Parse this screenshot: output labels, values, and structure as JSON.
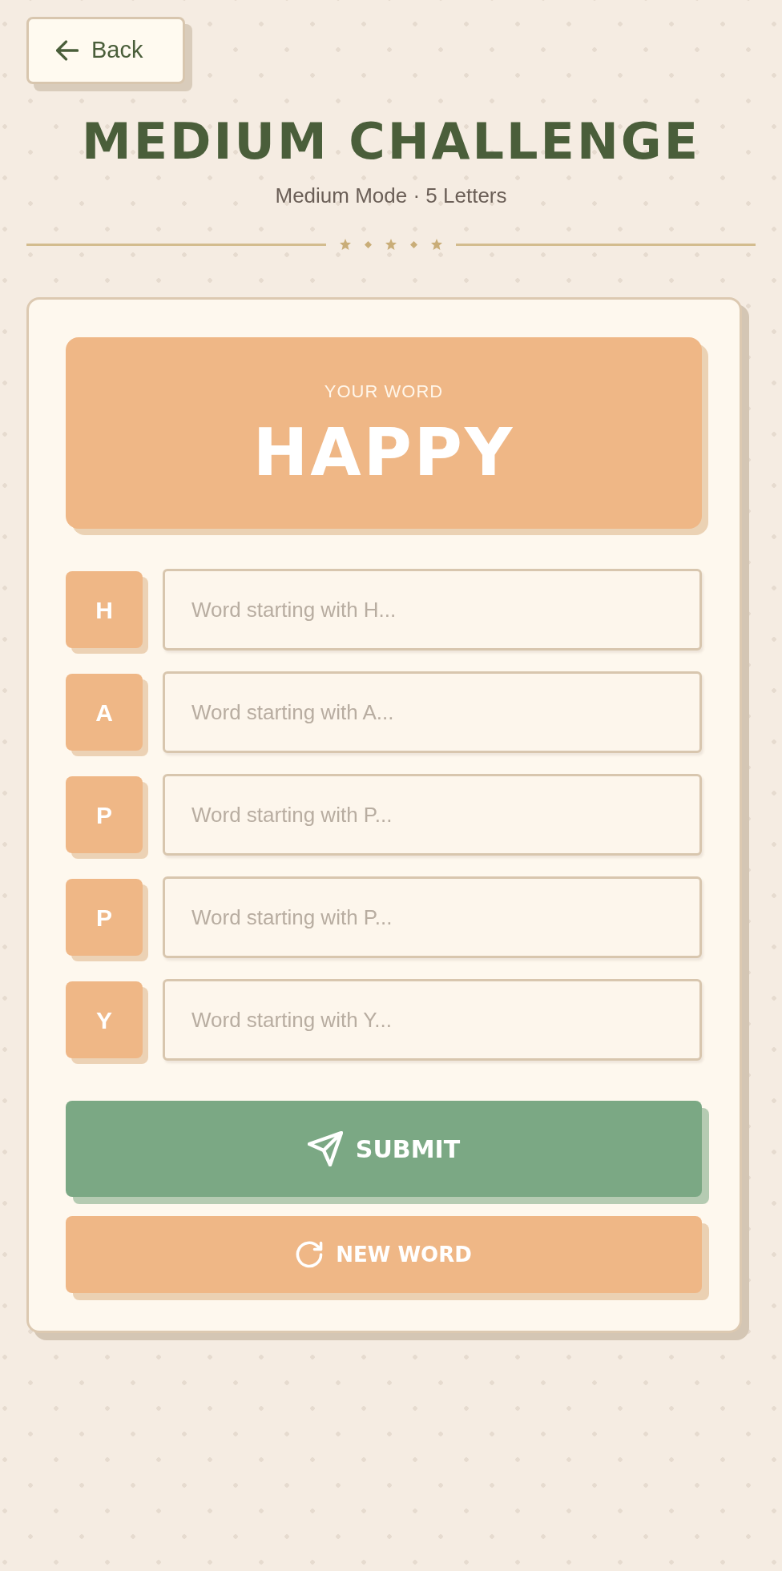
{
  "back_button": {
    "label": "Back"
  },
  "header": {
    "title": "MEDIUM CHALLENGE",
    "subtitle": "Medium Mode · 5 Letters"
  },
  "word_card": {
    "caption": "YOUR WORD",
    "word": "HAPPY"
  },
  "letters": [
    {
      "letter": "H",
      "placeholder": "Word starting with H..."
    },
    {
      "letter": "A",
      "placeholder": "Word starting with A..."
    },
    {
      "letter": "P",
      "placeholder": "Word starting with P..."
    },
    {
      "letter": "P",
      "placeholder": "Word starting with P..."
    },
    {
      "letter": "Y",
      "placeholder": "Word starting with Y..."
    }
  ],
  "buttons": [
    {
      "kind": "submit",
      "label": "SUBMIT"
    },
    {
      "kind": "new_word",
      "label": "NEW WORD"
    }
  ]
}
